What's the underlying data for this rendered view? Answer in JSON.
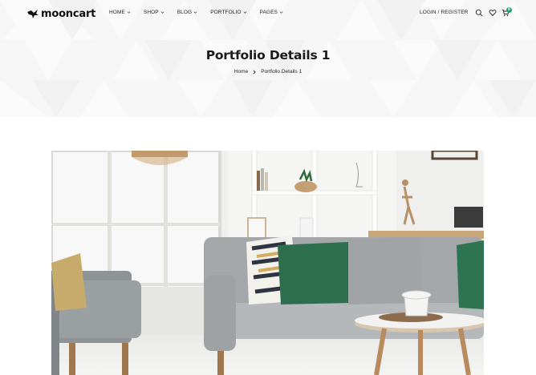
{
  "header": {
    "logo_text": "mooncart",
    "nav": [
      {
        "label": "HOME"
      },
      {
        "label": "SHOP"
      },
      {
        "label": "BLOG"
      },
      {
        "label": "PORTFOLIO"
      },
      {
        "label": "PAGES"
      }
    ],
    "login_label": "LOGIN / REGISTER",
    "cart_count": "0",
    "icons": [
      "search-icon",
      "heart-icon",
      "cart-icon"
    ]
  },
  "hero": {
    "title": "Portfolio Details 1",
    "breadcrumb": {
      "home": "Home",
      "current": "Portfolio Details 1"
    }
  },
  "colors": {
    "accent": "#1f9b6d",
    "hero_bg": "#f6f6f6",
    "text": "#1b1b1b"
  }
}
